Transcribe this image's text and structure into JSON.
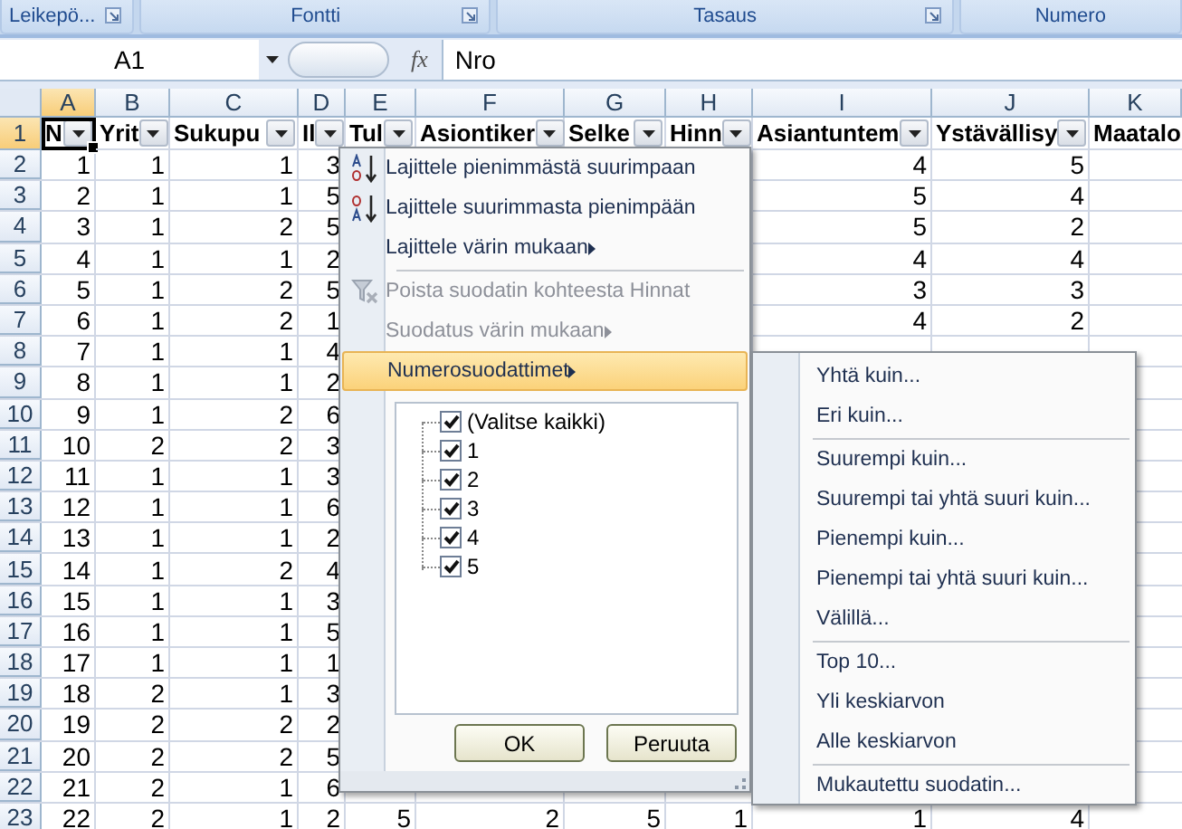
{
  "ribbon_groups": [
    {
      "label": "Leikepö...",
      "launcher": true
    },
    {
      "label": "Fontti",
      "launcher": true
    },
    {
      "label": "Tasaus",
      "launcher": true
    },
    {
      "label": "Numero",
      "launcher": false
    }
  ],
  "name_box": {
    "value": "A1"
  },
  "formula_bar": {
    "function_symbol": "fx",
    "value": "Nro"
  },
  "columns": [
    {
      "letter": "A",
      "selected": true
    },
    {
      "letter": "B",
      "selected": false
    },
    {
      "letter": "C",
      "selected": false
    },
    {
      "letter": "D",
      "selected": false
    },
    {
      "letter": "E",
      "selected": false
    },
    {
      "letter": "F",
      "selected": false
    },
    {
      "letter": "G",
      "selected": false
    },
    {
      "letter": "H",
      "selected": false
    },
    {
      "letter": "I",
      "selected": false
    },
    {
      "letter": "J",
      "selected": false
    },
    {
      "letter": "K",
      "selected": false
    }
  ],
  "header_row": {
    "number": "1",
    "selected": true,
    "cells": [
      {
        "text": "N",
        "filter_button": true,
        "selected": true
      },
      {
        "text": "Yrit",
        "filter_button": true,
        "selected": false
      },
      {
        "text": "Sukupu",
        "filter_button": true,
        "selected": false
      },
      {
        "text": "Il",
        "filter_button": true,
        "selected": false
      },
      {
        "text": "Tul",
        "filter_button": true,
        "selected": false
      },
      {
        "text": "Asiontiker",
        "filter_button": true,
        "selected": false
      },
      {
        "text": "Selke",
        "filter_button": true,
        "selected": false
      },
      {
        "text": "Hinn",
        "filter_button": true,
        "selected": false
      },
      {
        "text": "Asiantuntem",
        "filter_button": true,
        "selected": false
      },
      {
        "text": "Ystävällisy",
        "filter_button": true,
        "selected": false
      },
      {
        "text": "Maatalo",
        "filter_button": false,
        "selected": false
      }
    ]
  },
  "rows": [
    {
      "number": "2",
      "selected": false,
      "cells": [
        "1",
        "1",
        "1",
        "3"
      ],
      "right_cells": [
        "4",
        "5"
      ]
    },
    {
      "number": "3",
      "selected": false,
      "cells": [
        "2",
        "1",
        "1",
        "5"
      ],
      "right_cells": [
        "5",
        "4"
      ]
    },
    {
      "number": "4",
      "selected": false,
      "cells": [
        "3",
        "1",
        "2",
        "5"
      ],
      "right_cells": [
        "5",
        "2"
      ]
    },
    {
      "number": "5",
      "selected": false,
      "cells": [
        "4",
        "1",
        "1",
        "2"
      ],
      "right_cells": [
        "4",
        "4"
      ]
    },
    {
      "number": "6",
      "selected": false,
      "cells": [
        "5",
        "1",
        "2",
        "5"
      ],
      "right_cells": [
        "3",
        "3"
      ]
    },
    {
      "number": "7",
      "selected": false,
      "cells": [
        "6",
        "1",
        "2",
        "1"
      ],
      "right_cells": [
        "4",
        "2"
      ]
    },
    {
      "number": "8",
      "selected": false,
      "cells": [
        "7",
        "1",
        "1",
        "4"
      ]
    },
    {
      "number": "9",
      "selected": false,
      "cells": [
        "8",
        "1",
        "1",
        "2"
      ]
    },
    {
      "number": "10",
      "selected": false,
      "cells": [
        "9",
        "1",
        "2",
        "6"
      ]
    },
    {
      "number": "11",
      "selected": false,
      "cells": [
        "10",
        "2",
        "2",
        "3"
      ]
    },
    {
      "number": "12",
      "selected": false,
      "cells": [
        "11",
        "1",
        "1",
        "3"
      ]
    },
    {
      "number": "13",
      "selected": false,
      "cells": [
        "12",
        "1",
        "1",
        "6"
      ]
    },
    {
      "number": "14",
      "selected": false,
      "cells": [
        "13",
        "1",
        "1",
        "2"
      ]
    },
    {
      "number": "15",
      "selected": false,
      "cells": [
        "14",
        "1",
        "2",
        "4"
      ]
    },
    {
      "number": "16",
      "selected": false,
      "cells": [
        "15",
        "1",
        "1",
        "3"
      ]
    },
    {
      "number": "17",
      "selected": false,
      "cells": [
        "16",
        "1",
        "1",
        "5"
      ]
    },
    {
      "number": "18",
      "selected": false,
      "cells": [
        "17",
        "1",
        "1",
        "1"
      ]
    },
    {
      "number": "19",
      "selected": false,
      "cells": [
        "18",
        "2",
        "1",
        "3"
      ]
    },
    {
      "number": "20",
      "selected": false,
      "cells": [
        "19",
        "2",
        "2",
        "2"
      ]
    },
    {
      "number": "21",
      "selected": false,
      "cells": [
        "20",
        "2",
        "2",
        "5"
      ]
    },
    {
      "number": "22",
      "selected": false,
      "cells": [
        "21",
        "2",
        "1",
        "6"
      ]
    },
    {
      "number": "23",
      "selected": false,
      "cells": [
        "22",
        "2",
        "1",
        "2",
        "5",
        "2",
        "5",
        "1",
        "1",
        "4"
      ]
    }
  ],
  "filter_menu": {
    "items": [
      {
        "label": "Lajittele pienimmästä suurimpaan",
        "kind": "sort_ascending",
        "disabled": false,
        "submenu": false,
        "highlighted": false,
        "separator_before": false
      },
      {
        "label": "Lajittele suurimmasta pienimpään",
        "kind": "sort_descending",
        "disabled": false,
        "submenu": false,
        "highlighted": false,
        "separator_before": false
      },
      {
        "label": "Lajittele värin mukaan",
        "kind": "plain",
        "disabled": false,
        "submenu": true,
        "highlighted": false,
        "separator_before": false
      },
      {
        "label": "Poista suodatin kohteesta Hinnat",
        "kind": "clear_filter",
        "disabled": true,
        "submenu": false,
        "highlighted": false,
        "separator_before": true
      },
      {
        "label": "Suodatus värin mukaan",
        "kind": "plain",
        "disabled": true,
        "submenu": true,
        "highlighted": false,
        "separator_before": false
      },
      {
        "label": "Numerosuodattimet",
        "kind": "plain",
        "disabled": false,
        "submenu": true,
        "highlighted": true,
        "separator_before": false
      }
    ],
    "values": [
      {
        "label": "(Valitse kaikki)",
        "checked": true
      },
      {
        "label": "1",
        "checked": true
      },
      {
        "label": "2",
        "checked": true
      },
      {
        "label": "3",
        "checked": true
      },
      {
        "label": "4",
        "checked": true
      },
      {
        "label": "5",
        "checked": true
      }
    ],
    "buttons": [
      "OK",
      "Peruuta"
    ]
  },
  "number_filters_menu": {
    "items": [
      {
        "label": "Yhtä kuin...",
        "separator_before": false
      },
      {
        "label": "Eri kuin...",
        "separator_before": false
      },
      {
        "label": "Suurempi kuin...",
        "separator_before": true
      },
      {
        "label": "Suurempi tai yhtä suuri kuin...",
        "separator_before": false
      },
      {
        "label": "Pienempi kuin...",
        "separator_before": false
      },
      {
        "label": "Pienempi tai yhtä suuri kuin...",
        "separator_before": false
      },
      {
        "label": "Välillä...",
        "separator_before": false
      },
      {
        "label": "Top 10...",
        "separator_before": true
      },
      {
        "label": "Yli keskiarvon",
        "separator_before": false
      },
      {
        "label": "Alle keskiarvon",
        "separator_before": false
      },
      {
        "label": "Mukautettu suodatin...",
        "separator_before": true
      }
    ]
  }
}
